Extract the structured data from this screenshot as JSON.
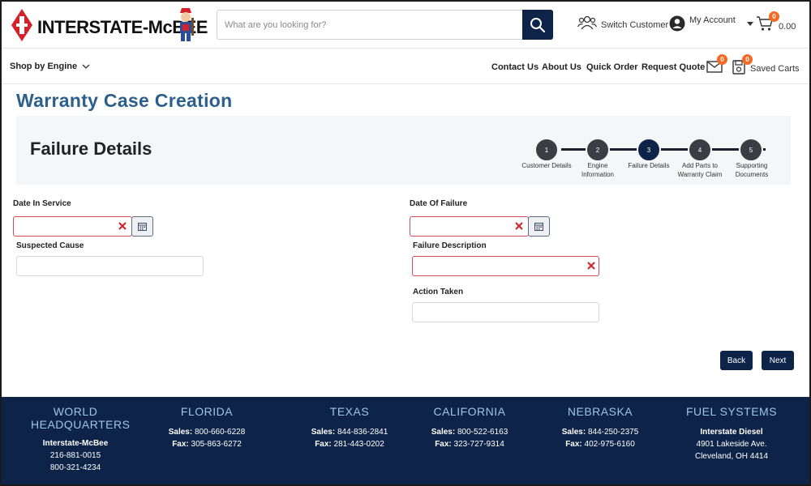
{
  "header": {
    "logo_text": "INTERSTATE-McBEE",
    "search_placeholder": "What are you looking for?",
    "switch_customer": "Switch Customer",
    "my_account": "My Account",
    "cart_count": "0",
    "cart_total": "0.00"
  },
  "nav": {
    "shop_by_engine": "Shop by Engine",
    "links": [
      "Contact Us",
      "About Us",
      "Quick Order",
      "Request Quote"
    ],
    "messages_count": "0",
    "saved_carts_count": "0",
    "saved_carts": "Saved Carts"
  },
  "page": {
    "title": "Warranty Case Creation",
    "section_title": "Failure Details"
  },
  "steps": [
    {
      "num": "1",
      "label": "Customer Details"
    },
    {
      "num": "2",
      "label": "Engine Information"
    },
    {
      "num": "3",
      "label": "Failure Details",
      "active": true
    },
    {
      "num": "4",
      "label": "Add Parts to Warranty Claim"
    },
    {
      "num": "5",
      "label": "Supporting Documents"
    }
  ],
  "form": {
    "date_in_service_label": "Date In Service",
    "date_of_failure_label": "Date Of Failure",
    "suspected_cause_label": "Suspected Cause",
    "failure_description_label": "Failure Description",
    "action_taken_label": "Action Taken",
    "date_in_service_value": "",
    "date_of_failure_value": "",
    "suspected_cause_value": "",
    "failure_description_value": "",
    "action_taken_value": ""
  },
  "buttons": {
    "back": "Back",
    "next": "Next"
  },
  "footer": {
    "columns": [
      {
        "heading": "WORLD HEADQUARTERS",
        "lines": [
          "Interstate-McBee",
          "216-881-0015",
          "800-321-4234"
        ]
      },
      {
        "heading": "FLORIDA",
        "sales": "800-660-6228",
        "fax": "305-863-6272"
      },
      {
        "heading": "TEXAS",
        "sales": "844-836-2841",
        "fax": "281-443-0202"
      },
      {
        "heading": "CALIFORNIA",
        "sales": "800-522-6163",
        "fax": "323-727-9314"
      },
      {
        "heading": "NEBRASKA",
        "sales": "844-250-2375",
        "fax": "402-975-6160"
      },
      {
        "heading": "FUEL SYSTEMS",
        "lines": [
          "Interstate Diesel",
          "4901 Lakeside Ave.",
          "Cleveland, OH 4414"
        ]
      }
    ],
    "sales_label": "Sales:",
    "fax_label": "Fax:"
  },
  "colors": {
    "navy": "#0d2448",
    "title_blue": "#2b5f8e",
    "badge_orange": "#f26a24",
    "error_red": "#d84a57",
    "footer_heading": "#9fc3e6"
  }
}
